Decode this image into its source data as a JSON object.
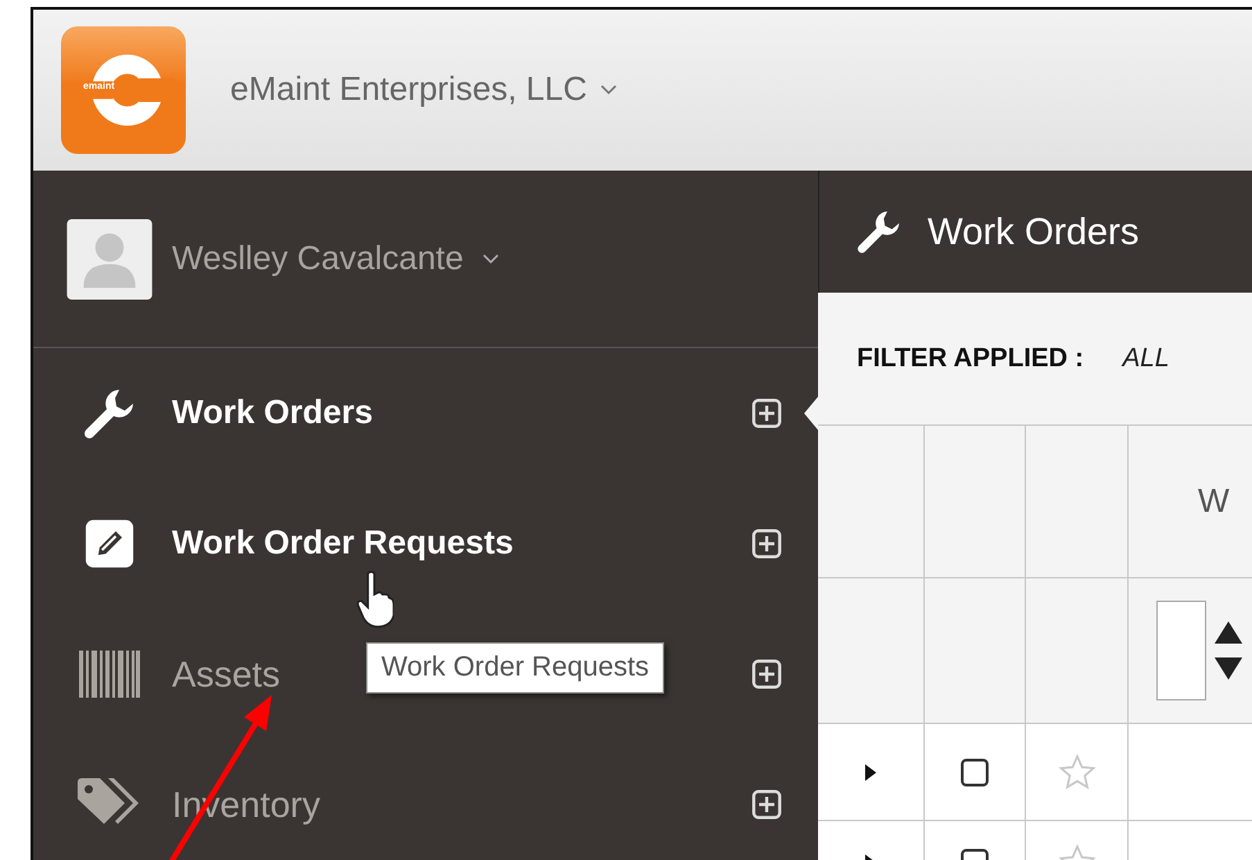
{
  "company": {
    "logo_text": "emaint",
    "name": "eMaint Enterprises, LLC"
  },
  "user": {
    "name": "Weslley Cavalcante"
  },
  "nav": [
    {
      "label": "Work Orders",
      "kind": "wrench",
      "selected": true,
      "hovered": false
    },
    {
      "label": "Work Order Requests",
      "kind": "pencil",
      "selected": false,
      "hovered": true
    },
    {
      "label": "Assets",
      "kind": "barcode",
      "selected": false,
      "hovered": false
    },
    {
      "label": "Inventory",
      "kind": "tag",
      "selected": false,
      "hovered": false
    }
  ],
  "tooltip": "Work Order Requests",
  "content": {
    "title": "Work Orders",
    "filter_label": "FILTER APPLIED :",
    "filter_value": "ALL",
    "table": {
      "column_4": "W",
      "rows": [
        {
          "expanded": false,
          "checked": false,
          "starred": false
        },
        {
          "expanded": false,
          "checked": false,
          "starred": false
        }
      ]
    }
  }
}
